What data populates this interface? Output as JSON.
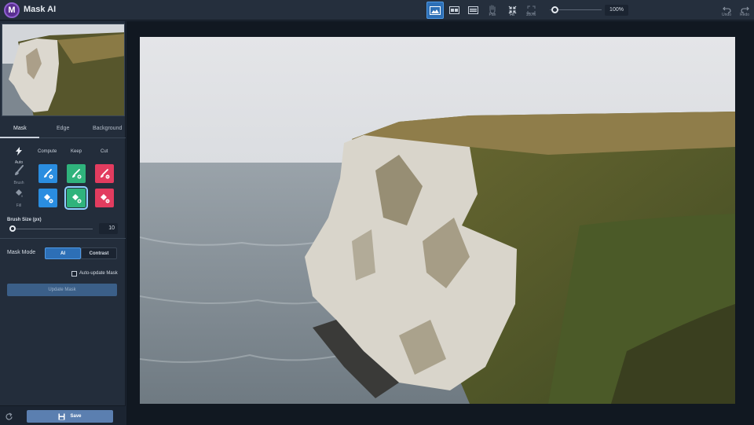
{
  "app": {
    "title": "Mask AI",
    "logo_letter": "M"
  },
  "toolbar": {
    "view_buttons": [
      {
        "name": "single-view",
        "active": true
      },
      {
        "name": "split-view",
        "active": false
      },
      {
        "name": "side-by-side-view",
        "active": false
      }
    ],
    "pan_label": "Pan",
    "fit_label": "Fit",
    "zoom_100_label": "100%",
    "zoom_value": "100%",
    "undo_label": "Undo",
    "redo_label": "Redo"
  },
  "sidebar": {
    "tabs": [
      {
        "label": "Mask",
        "active": true
      },
      {
        "label": "Edge",
        "active": false
      },
      {
        "label": "Background",
        "active": false
      }
    ],
    "columns": [
      "Compute",
      "Keep",
      "Cut"
    ],
    "tools": {
      "auto_label": "Auto",
      "brush_label": "Brush",
      "fill_label": "Fill"
    },
    "brush_size": {
      "label": "Brush Size (px)",
      "value": "10"
    },
    "mask_mode": {
      "label": "Mask Mode",
      "options": [
        "AI",
        "Contrast"
      ],
      "selected": "AI"
    },
    "auto_update": {
      "label": "Auto-update Mask",
      "checked": false
    },
    "update_button": "Update Mask",
    "save_button": "Save"
  },
  "colors": {
    "compute": "#2a8de0",
    "keep": "#2fb37c",
    "cut": "#e23c5f",
    "accent": "#2d6fb6"
  }
}
